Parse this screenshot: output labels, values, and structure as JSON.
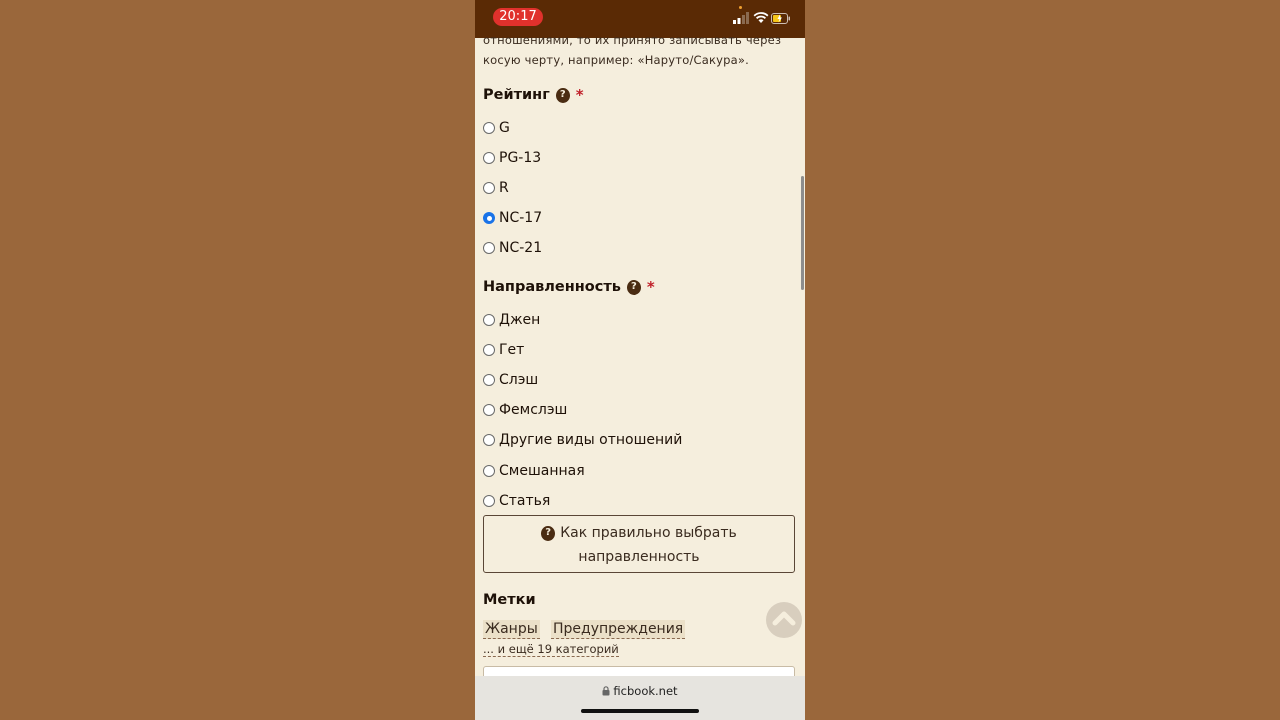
{
  "status": {
    "time": "20:17"
  },
  "intro_text": "отношениями, то их принято записывать через косую черту, например: «Наруто/Сакура».",
  "rating": {
    "title": "Рейтинг",
    "help": "?",
    "required": "*",
    "options": [
      "G",
      "PG-13",
      "R",
      "NC-17",
      "NC-21"
    ],
    "selected": "NC-17"
  },
  "direction": {
    "title": "Направленность",
    "help": "?",
    "required": "*",
    "options": [
      "Джен",
      "Гет",
      "Слэш",
      "Фемслэш",
      "Другие виды отношений",
      "Смешанная",
      "Статья"
    ]
  },
  "help_button": {
    "label": "Как правильно выбрать направленность"
  },
  "tags": {
    "title": "Метки",
    "links": [
      "Жанры",
      "Предупреждения"
    ],
    "more": "... и ещё 19 категорий"
  },
  "browser": {
    "url": "ficbook.net"
  },
  "colors": {
    "accent": "#1a73e8",
    "required": "#c0202a",
    "statusbar": "#5a2a05",
    "page_bg": "#f5eedd"
  }
}
